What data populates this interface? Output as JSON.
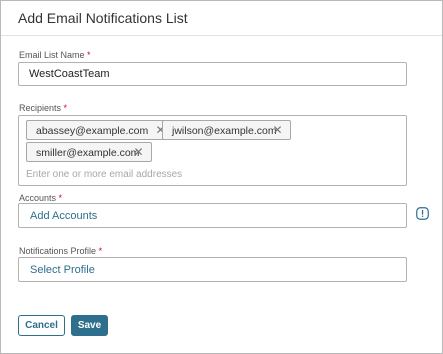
{
  "dialog": {
    "title": "Add Email Notifications List"
  },
  "form": {
    "email_list_name": {
      "label": "Email List Name",
      "required_marker": "*",
      "value": "WestCoastTeam"
    },
    "recipients": {
      "label": "Recipients",
      "required_marker": "*",
      "chips": [
        {
          "email": "abassey@example.com"
        },
        {
          "email": "jwilson@example.com"
        },
        {
          "email": "smiller@example.com"
        }
      ],
      "placeholder": "Enter one or more email addresses"
    },
    "accounts": {
      "label": "Accounts",
      "required_marker": "*",
      "action_label": "Add Accounts",
      "info_icon": "info-icon"
    },
    "notifications_profile": {
      "label": "Notifications Profile",
      "required_marker": "*",
      "action_label": "Select Profile"
    }
  },
  "footer": {
    "cancel_label": "Cancel",
    "save_label": "Save"
  },
  "colors": {
    "accent": "#2d6f8c",
    "required": "#d0021b",
    "border": "#b3b3b3"
  }
}
